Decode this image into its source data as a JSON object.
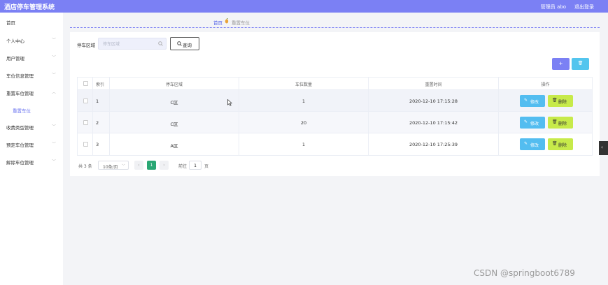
{
  "app": {
    "title": "酒店停车管理系统",
    "admin_label": "管理员 abo",
    "logout_label": "退出登录"
  },
  "sidebar": {
    "items": [
      {
        "label": "首页",
        "has_chevron": false
      },
      {
        "label": "个人中心",
        "has_chevron": true
      },
      {
        "label": "用户管理",
        "has_chevron": true
      },
      {
        "label": "车位信息管理",
        "has_chevron": true
      },
      {
        "label": "重置车位管理",
        "has_chevron": true
      },
      {
        "label": "重置车位",
        "has_chevron": false,
        "sub": true
      },
      {
        "label": "收费类型管理",
        "has_chevron": true
      },
      {
        "label": "预定车位管理",
        "has_chevron": true
      },
      {
        "label": "解除车位管理",
        "has_chevron": true
      }
    ],
    "chevron_glyph": "﹀"
  },
  "breadcrumb": {
    "home": "首页",
    "current": "重置车位"
  },
  "search": {
    "field_label": "停车区域",
    "placeholder": "停车区域",
    "value": "",
    "query_label": "查询"
  },
  "toolbar": {
    "add_glyph": "+",
    "delete_glyph": "🗑"
  },
  "table": {
    "columns": [
      "索引",
      "停车区域",
      "车位数量",
      "重置时间",
      "操作"
    ],
    "rows": [
      {
        "index": "1",
        "area": "C区",
        "count": "1",
        "time": "2020-12-10 17:15:28"
      },
      {
        "index": "2",
        "area": "C区",
        "count": "20",
        "time": "2020-12-10 17:15:42"
      },
      {
        "index": "3",
        "area": "A区",
        "count": "1",
        "time": "2020-12-10 17:25:39"
      }
    ],
    "edit_label": "修改",
    "delete_label": "删除",
    "edit_glyph": "✎",
    "delete_glyph": "🗑"
  },
  "pagination": {
    "total": "共 3 条",
    "page_size": "10条/页",
    "current_page": "1",
    "prev_glyph": "‹",
    "next_glyph": "›",
    "goto_label": "前往",
    "goto_value": "1",
    "page_suffix": "页"
  },
  "collapse_glyph": "‹",
  "watermark": "CSDN @springboot6789",
  "colors": {
    "accent": "#7b80f4",
    "edit": "#53bdf0",
    "delete": "#c7ea4a",
    "pager_active": "#2aa774"
  }
}
